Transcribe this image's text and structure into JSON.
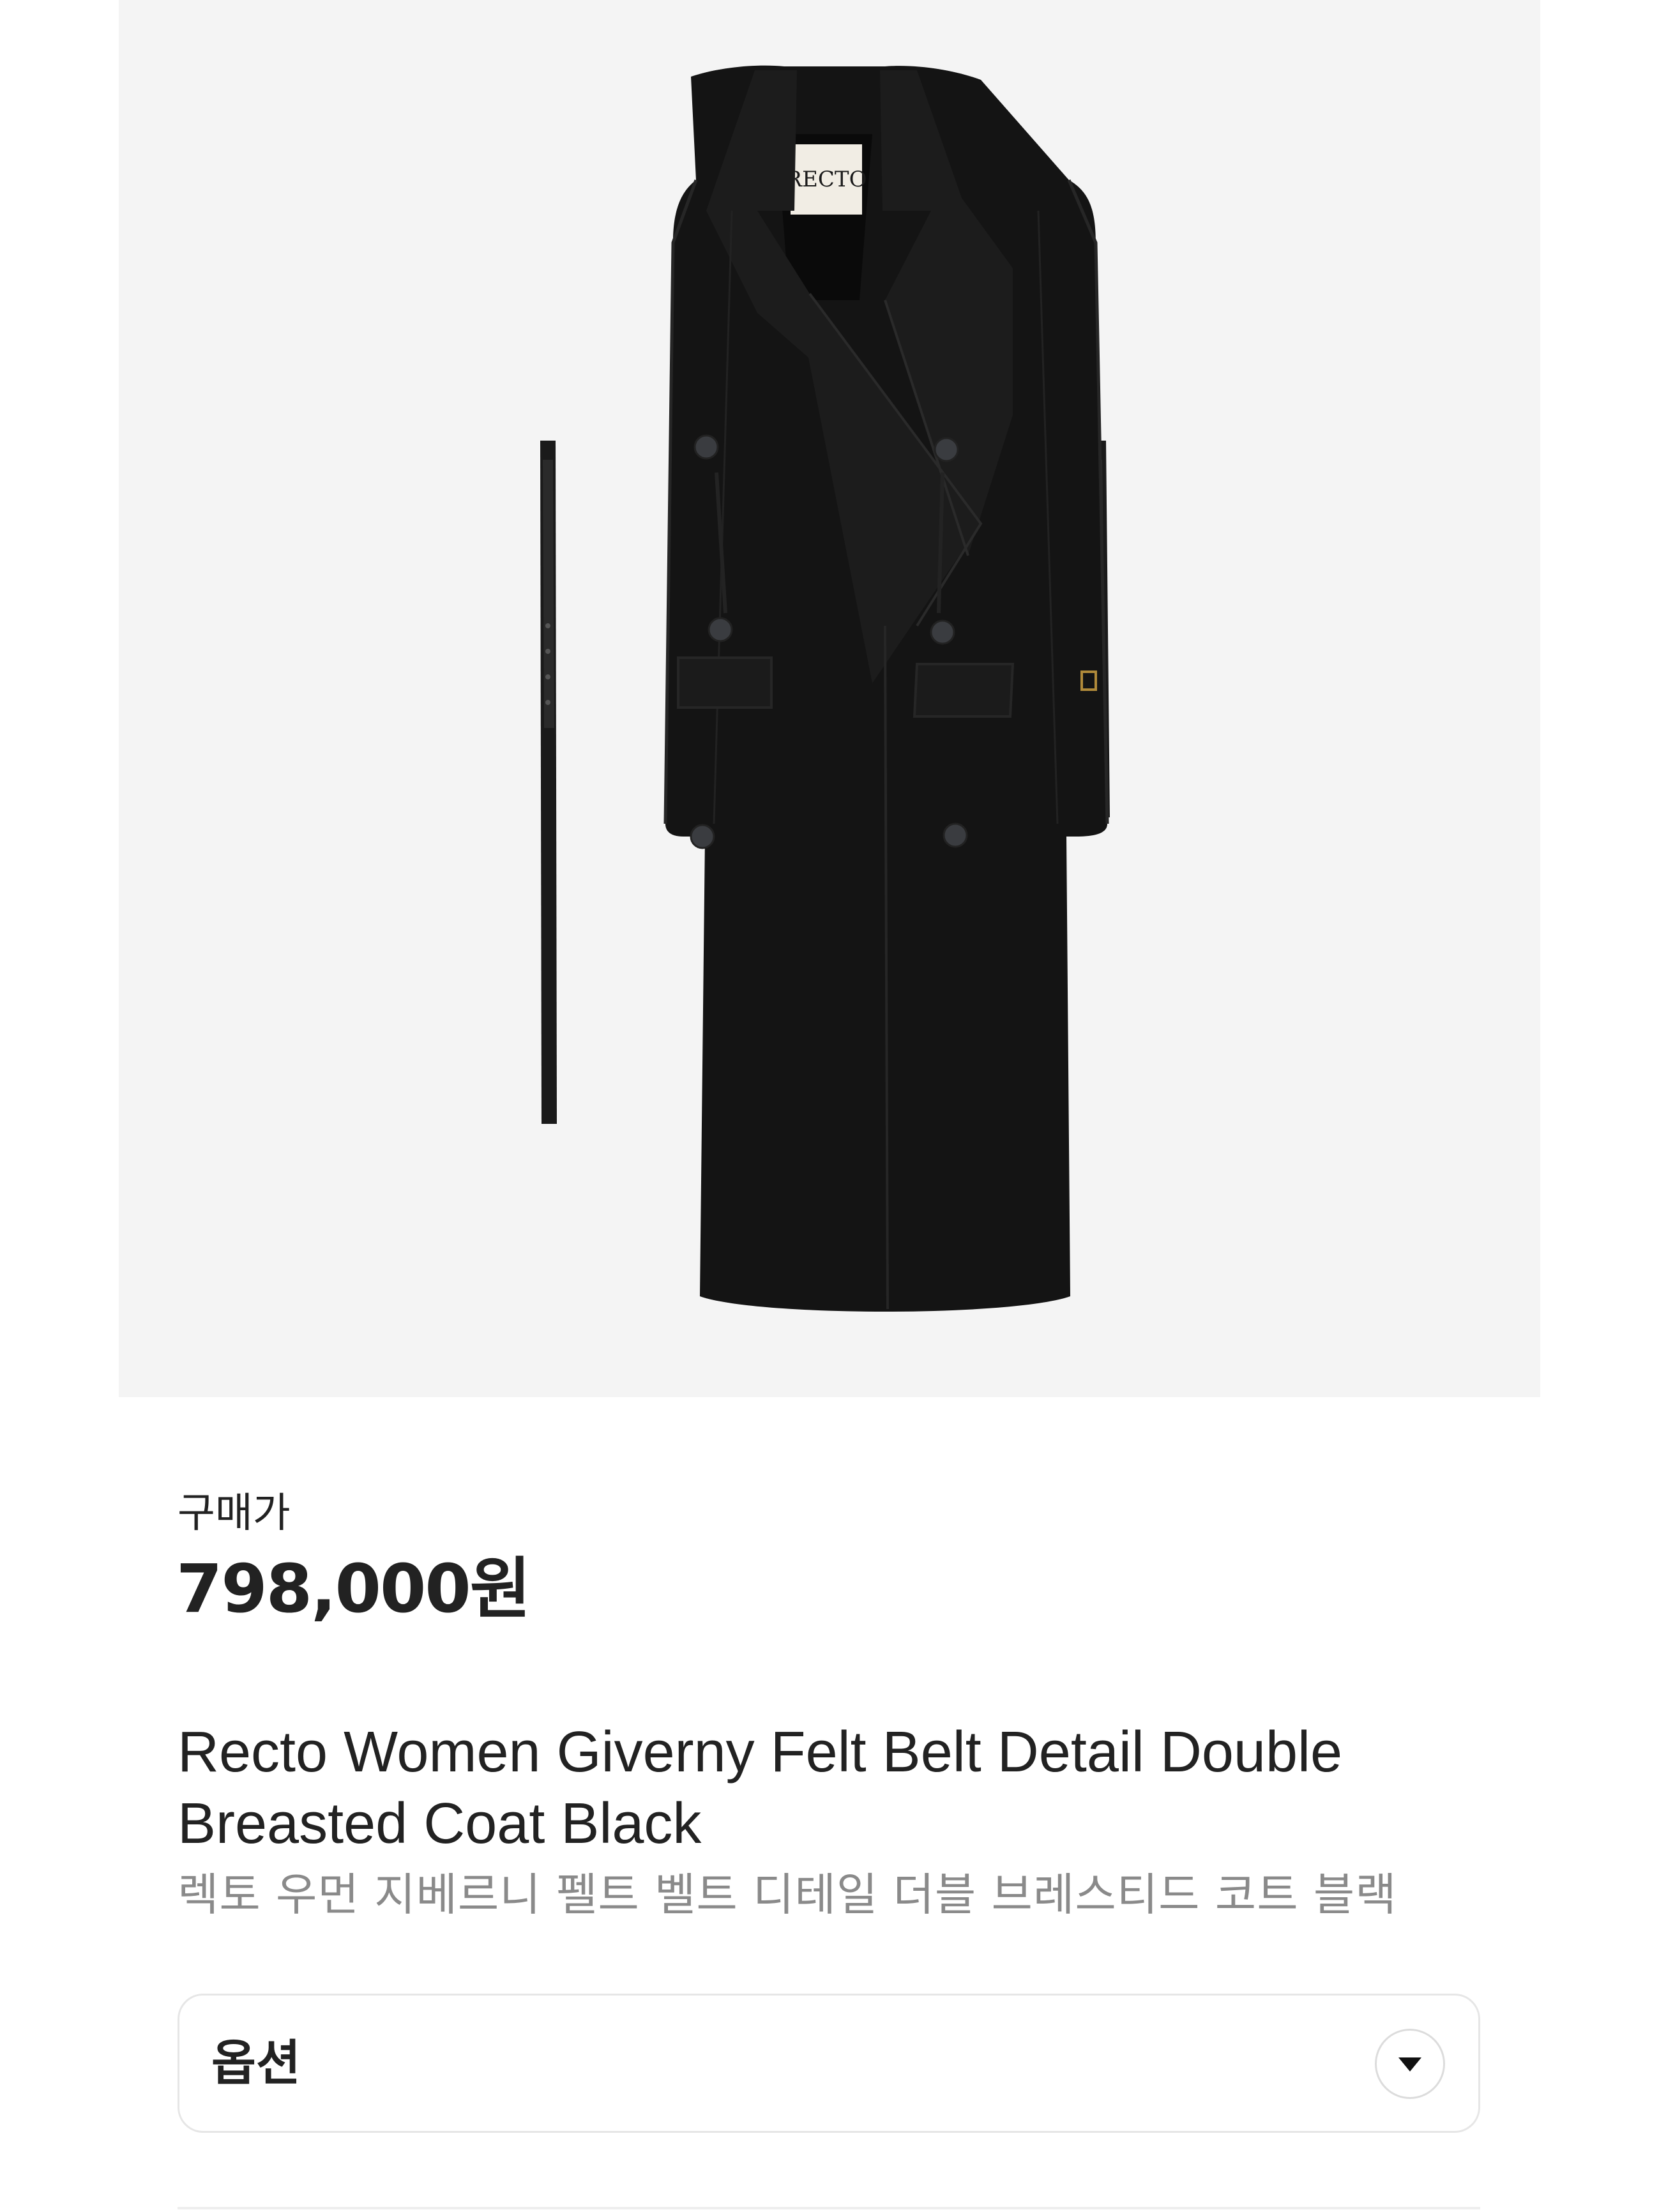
{
  "product": {
    "image_alt": "Recto Women Giverny Felt Belt Detail Double Breasted Coat Black",
    "brand_label": "RECTO",
    "price_label": "구매가",
    "price": "798,000원",
    "title_en": "Recto Women Giverny Felt Belt Detail Double Breasted Coat Black",
    "title_ko": "렉토 우먼 지베르니 펠트 벨트 디테일 더블 브레스티드 코트 블랙"
  },
  "options": {
    "label": "옵션",
    "toggle_icon": "chevron-down-icon"
  },
  "colors": {
    "image_background": "#f4f4f4",
    "coat": "#141414",
    "text_primary": "#222222",
    "text_secondary": "#8a8a8a",
    "border": "#e6e6e6"
  }
}
